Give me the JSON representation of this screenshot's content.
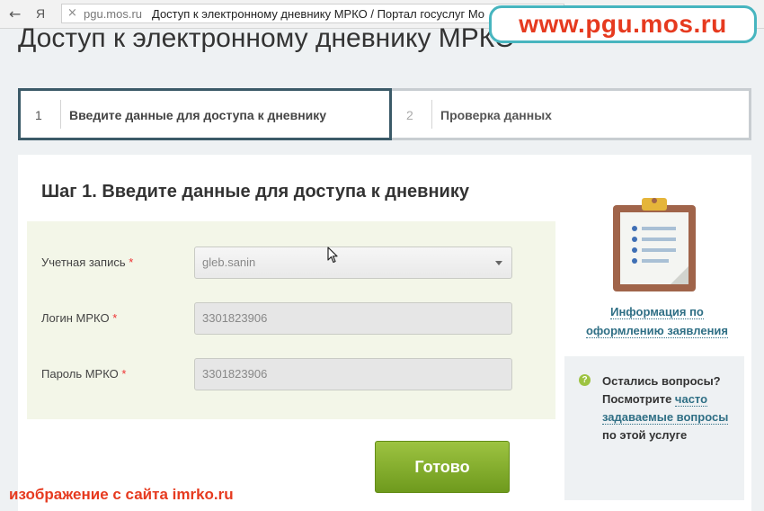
{
  "browser": {
    "back_icon": "arrow-left-icon",
    "ya_logo": "Я",
    "tab_close": "×",
    "url_domain": "pgu.mos.ru",
    "page_title": "Доступ к электронному дневнику МРКО / Портал госуслуг Мо"
  },
  "watermarks": {
    "top": "www.pgu.mos.ru",
    "bottom_prefix": "изображение с сайта",
    "bottom_site": "imrko.ru"
  },
  "page": {
    "title": "Доступ к электронному дневнику МРКО"
  },
  "steps": [
    {
      "number": "1",
      "label": "Введите данные для доступа к дневнику",
      "active": true
    },
    {
      "number": "2",
      "label": "Проверка данных",
      "active": false
    }
  ],
  "form": {
    "title": "Шаг 1. Введите данные для доступа к дневнику",
    "required_mark": "*",
    "fields": [
      {
        "label": "Учетная запись",
        "value": "gleb.sanin",
        "type": "select"
      },
      {
        "label": "Логин МРКО",
        "value": "3301823906",
        "type": "text"
      },
      {
        "label": "Пароль МРКО",
        "value": "3301823906",
        "type": "text"
      }
    ],
    "submit_label": "Готово"
  },
  "sidebar": {
    "info_link_line1": "Информация по",
    "info_link_line2": "оформлению заявления",
    "faq_icon": "?",
    "faq_text_1": "Остались вопросы? Посмотрите ",
    "faq_link": "часто задаваемые вопросы",
    "faq_text_2": " по этой услуге"
  },
  "colors": {
    "accent_green": "#8db634",
    "link_blue": "#2f6f85",
    "watermark_red": "#e63a1f",
    "active_step_border": "#3b5a68"
  }
}
